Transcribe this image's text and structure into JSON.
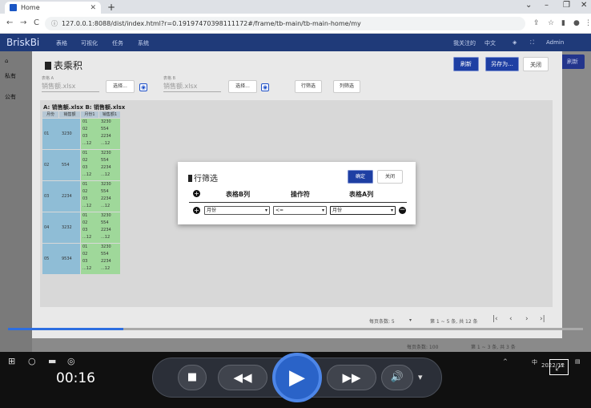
{
  "browser": {
    "tab_title": "Home",
    "url": "127.0.0.1:8088/dist/index.html?r=0.19197470398111172#/frame/tb-main/tb-main-home/my"
  },
  "app": {
    "logo": "BriskBi",
    "menu": [
      "表格",
      "可视化",
      "任务",
      "系统"
    ],
    "right": [
      "我关注的",
      "中文",
      "Admin"
    ],
    "bg_refresh": "刷新",
    "left_nav": [
      "私有",
      "公有"
    ]
  },
  "dialog": {
    "title": "表乘积",
    "refresh_label": "刷新",
    "save_as_label": "另存为...",
    "close_label": "关闭",
    "table_a_label": "表格 A",
    "table_a_value": "销售额.xlsx",
    "table_b_label": "表格 B",
    "table_b_value": "销售额.xlsx",
    "select_label": "选择...",
    "row_filter_label": "行筛选",
    "col_filter_label": "列筛选",
    "table_title": "A: 销售额.xlsx  B: 销售额.xlsx",
    "headers": [
      "月份",
      "销售额",
      "月份1",
      "销售额1"
    ],
    "groups": [
      {
        "month": "01",
        "sales": "3230"
      },
      {
        "month": "02",
        "sales": "554"
      },
      {
        "month": "03",
        "sales": "2234"
      },
      {
        "month": "04",
        "sales": "3232"
      },
      {
        "month": "05",
        "sales": "9534"
      }
    ],
    "inner_rows": [
      {
        "m": "01",
        "s": "3230"
      },
      {
        "m": "02",
        "s": "554"
      },
      {
        "m": "03",
        "s": "2234"
      },
      {
        "m": "...12",
        "s": "...12"
      }
    ],
    "pager_per_page": "每页条数: 5",
    "pager_range": "第 1 ~ 5 条, 共 12 条",
    "bg_pager_per_page": "每页条数: 100",
    "bg_pager_range": "第 1 ~ 3 条, 共 3 条"
  },
  "filter": {
    "title": "行筛选",
    "ok_label": "确定",
    "close_label": "关闭",
    "col_b": "表格B列",
    "operator": "操作符",
    "col_a": "表格A列",
    "sel_b": "月份",
    "sel_op": "<=",
    "sel_a": "月份"
  },
  "player": {
    "time": "00:16",
    "progress": 0.2
  },
  "taskbar": {
    "tray_text": "中",
    "date_text": "2022/12"
  }
}
